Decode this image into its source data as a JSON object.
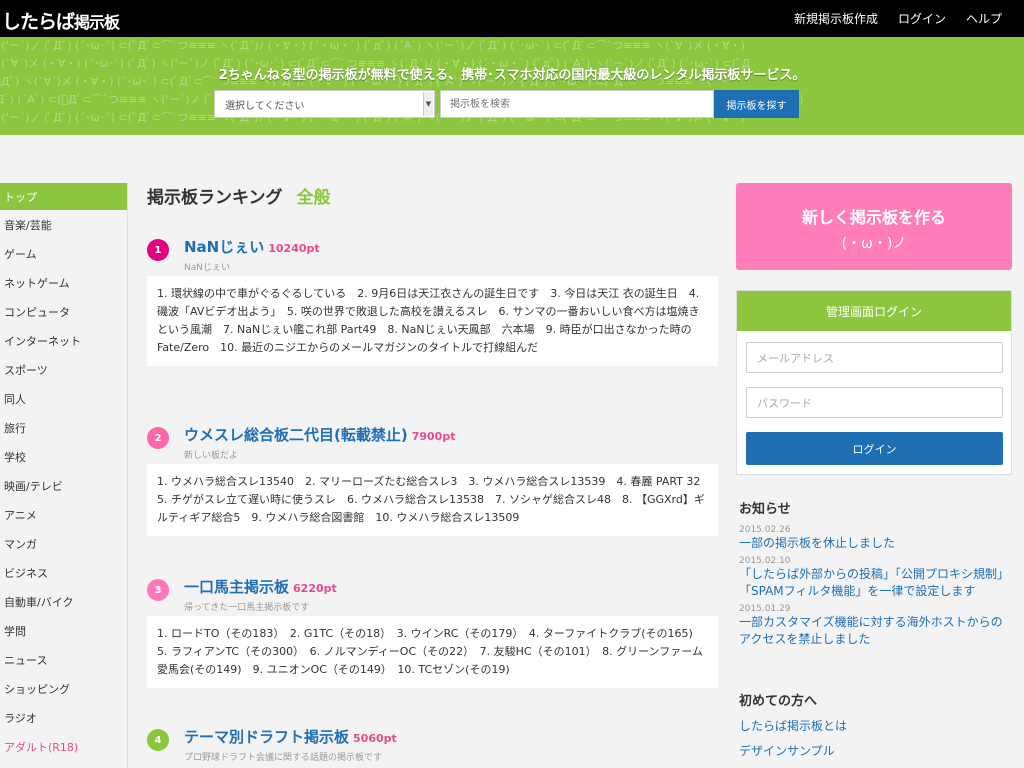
{
  "header": {
    "logo_main": "したらば",
    "logo_sub": "掲示板",
    "nav": [
      "新規掲示板作成",
      "ログイン",
      "ヘルプ"
    ]
  },
  "hero": {
    "pattern_lines": [
      "ヽ(‘ー`)ノ (ﾟДﾟ) (´･ω･`) ⊂(ﾟДﾟ⊂⌒`つ≡≡≡ ヽ(`Д´)ﾉ (・∀・) (´・ω・`) (ﾟдﾟ) (´Α`) ヽ(‘ー`)ノ (ﾟДﾟ) (´･ω･`) ⊂(ﾟДﾟ⊂⌒`つ≡≡≡ ヽ(`∀´)メ (・∀・)",
      "ヽ(`∀´)メ (・∀・) (´･ω･`) (ﾟДﾟ) ヽ(‘ー`)ノ (ﾟДﾟ) (´･ω･`) ⊂(ﾟДﾟ⊂⌒`つ≡≡≡ ヽ(`Д´)ﾉ (・∀・) (´・ω・`) (ﾟдﾟ) (´Α`) ヽ(‘ー`)ノ (ﾟДﾟ) (´･ω･`) ⊂(ﾟД",
      "(ﾟДﾟ) ヽ(`∀´)メ (・∀・) (´･ω･`) ⊂(ﾟДﾟ⊂⌒`つ≡≡≡ ヽ(`Д´)ﾉ (・∀・) (´・ω・`) (ﾟдﾟ) (´Α`) ヽ(‘ー`)ノ (ﾟДﾟ) (´･ω･`) ⊂(ﾟДﾟ⊂⌒`つ≡≡≡ ヽ(`ー",
      "ﾟДﾟ) (´Α`) ⊂(ﾟДﾟ⊂⌒`つ≡≡≡ ヽ(‘ー`)ノ (ﾟДﾟ) ヽ(`∀´)メ (・∀・) (´･ω･`) (´･ω･`) (ﾟдﾟ) (´Α`) ⊂(ﾟДﾟ⊂⌒`つ≡≡≡ ヽ(`Д´)ﾉ (ﾟДﾟ) ヽ(`∀´)メ (・∀・) (´・ω・`)",
      "ヽ(‘ー`)ノ (ﾟДﾟ) (´･ω･`) ⊂(ﾟДﾟ⊂⌒`つ≡≡≡ ヽ(`Д´)ﾉ (・∀・) (´・ω・`) (ﾟдﾟ) (´Α`) ヽ(‘ー`)ノ (ﾟДﾟ) (´･ω･`) ⊂(ﾟДﾟ⊂⌒`つ≡≡≡ ヽ(`∀´)メ (・∀・)"
    ],
    "tagline": "2ちゃんねる型の掲示板が無料で使える、携帯･スマホ対応の国内最大級のレンタル掲示板サービス。",
    "select_value": "選択してください",
    "search_placeholder": "掲示板を検索",
    "search_button": "掲示板を探す"
  },
  "sidebar": {
    "categories": [
      "トップ",
      "音楽/芸能",
      "ゲーム",
      "ネットゲーム",
      "コンピュータ",
      "インターネット",
      "スポーツ",
      "同人",
      "旅行",
      "学校",
      "映画/テレビ",
      "アニメ",
      "マンガ",
      "ビジネス",
      "自動車/バイク",
      "学問",
      "ニュース",
      "ショッピング",
      "ラジオ",
      "アダルト(R18)"
    ]
  },
  "ranking": {
    "title": "掲示板ランキング",
    "genre": "全般",
    "entries": [
      {
        "rank": "1",
        "name": "NaNじぇい",
        "points": "10240pt",
        "description": "NaNじぇい",
        "threads": "1. 環状線の中で車がぐるぐるしている　2. 9月6日は天江衣さんの誕生日です　3. 今日は天江 衣の誕生日　4. 磯波「AVビデオ出よう」　5. 咲の世界で敗退した高校を讃えるスレ　6. サンマの一番おいしい食べ方は塩焼きという風潮　7. NaNじぇい艦これ部 Part49　8. NaNじぇい天鳳部　六本場　9. 時臣が口出さなかった時のFate/Zero　10. 最近のニジエからのメールマガジンのタイトルで打線組んだ"
      },
      {
        "rank": "2",
        "name": "ウメスレ総合板二代目(転載禁止)",
        "points": "7900pt",
        "description": "新しい板だよ",
        "threads": "1. ウメハラ総合スレ13540　2. マリーローズたむ総合スレ3　3. ウメハラ総合スレ13539　4. 春麗 PART 32　5. チゲがスレ立て遅い時に使うスレ　6. ウメハラ総合スレ13538　7. ソシャゲ総合スレ48　8. 【GGXrd】ギルティギア総合5　9. ウメハラ総合図書館　10. ウメハラ総合スレ13509"
      },
      {
        "rank": "3",
        "name": "一口馬主掲示板",
        "points": "6220pt",
        "description": "帰ってきた一口馬主掲示板です",
        "threads": "1. ロードTO（その183）　2. G1TC（その18）　3. ウインRC（その179）　4. ターファイトクラブ(その165)　5. ラフィアンTC（その300）　6. ノルマンディーOC（その22）　7. 友駿HC（その101）　8. グリーンファーム愛馬会(その149)　9. ユニオンOC（その149）　10. TCセゾン(その19)"
      },
      {
        "rank": "4",
        "name": "テーマ別ドラフト掲示板",
        "points": "5060pt",
        "description": "プロ野球ドラフト会議に関する話題の掲示板です",
        "threads": ""
      }
    ]
  },
  "create_board": {
    "title": "新しく掲示板を作る",
    "face": "(・ω・)ノ"
  },
  "login": {
    "title": "管理画面ログイン",
    "email_placeholder": "メールアドレス",
    "password_placeholder": "パスワード",
    "button": "ログイン"
  },
  "news": {
    "title": "お知らせ",
    "items": [
      {
        "date": "2015.02.26",
        "text": "一部の掲示板を休止しました"
      },
      {
        "date": "2015.02.10",
        "text": "「したらば外部からの投稿」「公開プロキシ規制」「SPAMフィルタ機能」を一律で設定します"
      },
      {
        "date": "2015.01.29",
        "text": "一部カスタマイズ機能に対する海外ホストからのアクセスを禁止しました"
      }
    ]
  },
  "first_time": {
    "title": "初めての方へ",
    "links": [
      "したらば掲示板とは",
      "デザインサンプル"
    ]
  },
  "colors": {
    "accent_green": "#8cc63f",
    "link_blue": "#1f6fb5",
    "pink": "#ff7eb9",
    "points_pink": "#e94a8b",
    "rank_badges": [
      "#e5007f",
      "#ff66aa",
      "#ff77bb",
      "#8cc63f"
    ]
  }
}
